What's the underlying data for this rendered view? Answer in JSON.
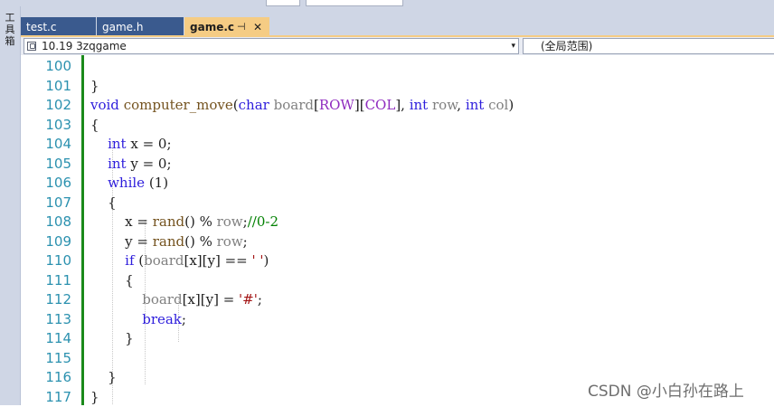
{
  "toolbox": {
    "label": "工具箱"
  },
  "tabs": [
    {
      "label": "test.c",
      "active": false
    },
    {
      "label": "game.h",
      "active": false
    },
    {
      "label": "game.c",
      "active": true,
      "pin": "⊣",
      "close": "✕"
    }
  ],
  "nav": {
    "project_combo": "10.19 3zqgame",
    "scope_combo": "(全局范围)"
  },
  "editor": {
    "lines": [
      {
        "n": "100",
        "code": ""
      },
      {
        "n": "101",
        "code": "}"
      },
      {
        "n": "102",
        "code": "void computer_move(char board[ROW][COL], int row, int col)"
      },
      {
        "n": "103",
        "code": "{"
      },
      {
        "n": "104",
        "code": "    int x = 0;"
      },
      {
        "n": "105",
        "code": "    int y = 0;"
      },
      {
        "n": "106",
        "code": "    while (1)"
      },
      {
        "n": "107",
        "code": "    {"
      },
      {
        "n": "108",
        "code": "        x = rand() % row;//0-2"
      },
      {
        "n": "109",
        "code": "        y = rand() % row;"
      },
      {
        "n": "110",
        "code": "        if (board[x][y] == ' ')"
      },
      {
        "n": "111",
        "code": "        {"
      },
      {
        "n": "112",
        "code": "            board[x][y] = '#';"
      },
      {
        "n": "113",
        "code": "            break;"
      },
      {
        "n": "114",
        "code": "        }"
      },
      {
        "n": "115",
        "code": ""
      },
      {
        "n": "116",
        "code": "    }"
      },
      {
        "n": "117",
        "code": "}"
      }
    ]
  },
  "watermark": "CSDN @小白孙在路上",
  "colors": {
    "keyword": "#2e1edc",
    "function": "#74531f",
    "parameter": "#808080",
    "macro": "#8f2bbf",
    "string": "#a31515",
    "comment": "#008000",
    "line_number": "#2b91af",
    "active_tab": "#f5cc84",
    "inactive_tab": "#3a5a8e",
    "change_bar": "#1b8a1b"
  }
}
